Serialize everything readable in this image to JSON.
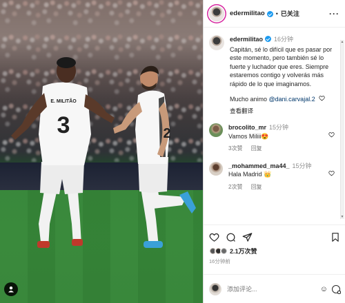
{
  "post": {
    "username": "edermilitao",
    "follow_status": "已关注",
    "separator": "•",
    "more_icon": "more-horizontal-icon"
  },
  "caption": {
    "username": "edermilitao",
    "time": "16分钟",
    "text": "Capitán, sé lo difícil que es pasar por este momento, pero también sé lo fuerte y luchador que eres. Siempre estaremos contigo y volverás más rápido de lo que imaginamos.",
    "line2_prefix": "Mucho animo ",
    "mention": "@dani.carvajal.2",
    "see_translation": "查看翻译"
  },
  "comments": [
    {
      "username": "brocolito_mr",
      "time": "15分钟",
      "text": "Vamos Miliii",
      "emoji": "😍",
      "likes": "3次赞",
      "reply": "回复"
    },
    {
      "username": "_mohammed_ma44_",
      "time": "15分钟",
      "text": "Hala Madrid",
      "emoji": "👑",
      "likes": "2次赞",
      "reply": "回复"
    }
  ],
  "engagement": {
    "likes_text": "2.1万次赞",
    "posted_ago": "16分钟前"
  },
  "add_comment": {
    "placeholder": "添加评论...",
    "emoji_icon": "emoji-icon"
  },
  "photo": {
    "player_left_name": "E. MILITÃO",
    "player_left_number": "3",
    "player_right_number": "2"
  },
  "colors": {
    "accent_blue": "#0095f6",
    "verified": "#1d9bf0",
    "mention": "#00376b",
    "muted_text": "#8e8e8e"
  }
}
